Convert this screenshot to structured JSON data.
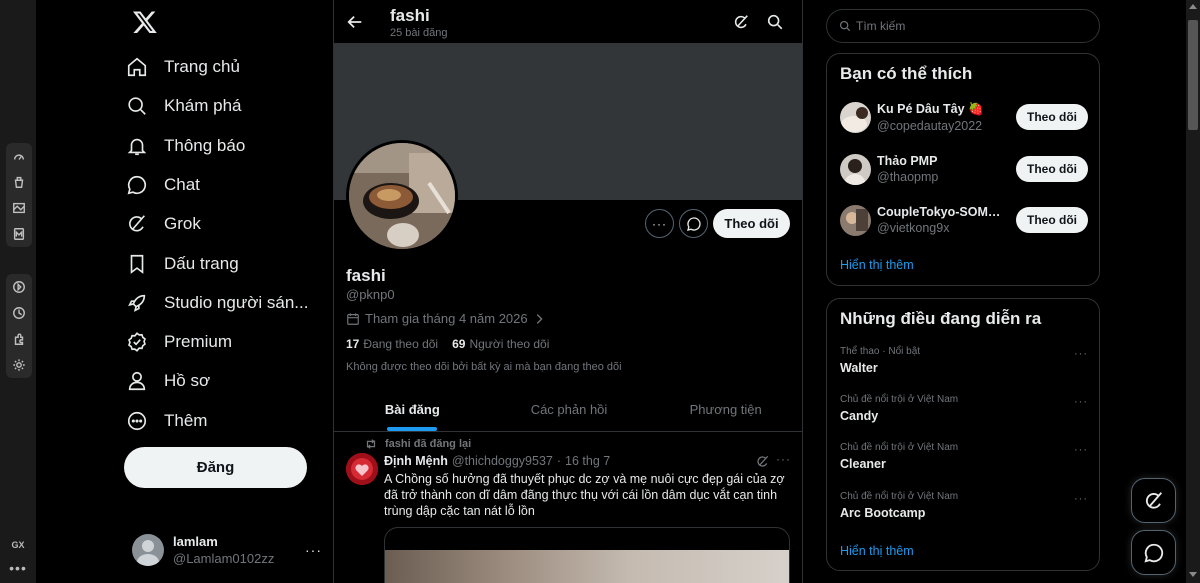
{
  "browser": {
    "gx_label": "GX",
    "gx_more": "•••"
  },
  "nav": {
    "items": [
      {
        "label": "Trang chủ",
        "icon": "home-icon"
      },
      {
        "label": "Khám phá",
        "icon": "search-icon"
      },
      {
        "label": "Thông báo",
        "icon": "bell-icon"
      },
      {
        "label": "Chat",
        "icon": "chat-icon"
      },
      {
        "label": "Grok",
        "icon": "grok-icon"
      },
      {
        "label": "Dấu trang",
        "icon": "bookmark-icon"
      },
      {
        "label": "Studio người sán...",
        "icon": "rocket-icon"
      },
      {
        "label": "Premium",
        "icon": "verified-icon"
      },
      {
        "label": "Hồ sơ",
        "icon": "person-icon"
      },
      {
        "label": "Thêm",
        "icon": "more-circle-icon"
      }
    ],
    "post_label": "Đăng"
  },
  "account": {
    "name": "lamlam",
    "handle": "@Lamlam0102zz",
    "more": "···"
  },
  "profile": {
    "top_name": "fashi",
    "post_count": "25 bài đăng",
    "name": "fashi",
    "handle": "@pknp0",
    "joined": "Tham gia tháng 4 năm 2026",
    "following_count": "17",
    "following_label": "Đang theo dõi",
    "followers_count": "69",
    "followers_label": "Người theo dõi",
    "not_followed": "Không được theo dõi bởi bất kỳ ai mà bạn đang theo dõi",
    "follow_label": "Theo dõi",
    "more": "···"
  },
  "tabs": [
    {
      "label": "Bài đăng",
      "active": true
    },
    {
      "label": "Các phản hồi",
      "active": false
    },
    {
      "label": "Phương tiện",
      "active": false
    }
  ],
  "tweet": {
    "repost": "fashi đã đăng lại",
    "author": "Định Mệnh",
    "handle": "@thichdoggy9537",
    "sep": "·",
    "date": "16 thg 7",
    "more": "···",
    "text": "A Chồng số hưởng đã thuyết phục dc zợ và mẹ nuôi cực đẹp gái của zợ đã trở thành con dĩ dâm đãng thực thụ với cái lồn dâm dục vắt cạn tinh trùng dập cặc tan nát lỗ lồn"
  },
  "search": {
    "placeholder": "Tìm kiếm"
  },
  "who_to_follow": {
    "title": "Bạn có thể thích",
    "items": [
      {
        "name": "Ku Pé Dâu Tây 🍓",
        "handle": "@copedautay2022",
        "follow": "Theo dõi"
      },
      {
        "name": "Thảo PMP",
        "handle": "@thaopmp",
        "follow": "Theo dõi"
      },
      {
        "name": "CoupleTokyo-SOME-...",
        "handle": "@vietkong9x",
        "follow": "Theo dõi"
      }
    ],
    "show_more": "Hiển thị thêm"
  },
  "trends": {
    "title": "Những điều đang diễn ra",
    "items": [
      {
        "meta": "Thể thao · Nổi bật",
        "name": "Walter"
      },
      {
        "meta": "Chủ đề nổi trội ở Việt Nam",
        "name": "Candy"
      },
      {
        "meta": "Chủ đề nổi trội ở Việt Nam",
        "name": "Cleaner"
      },
      {
        "meta": "Chủ đề nổi trội ở Việt Nam",
        "name": "Arc Bootcamp"
      }
    ],
    "more": "···",
    "show_more": "Hiển thị thêm"
  },
  "colors": {
    "accent": "#1d9bf0",
    "border": "#2f3336",
    "muted": "#71767b",
    "banner": "#333639"
  }
}
